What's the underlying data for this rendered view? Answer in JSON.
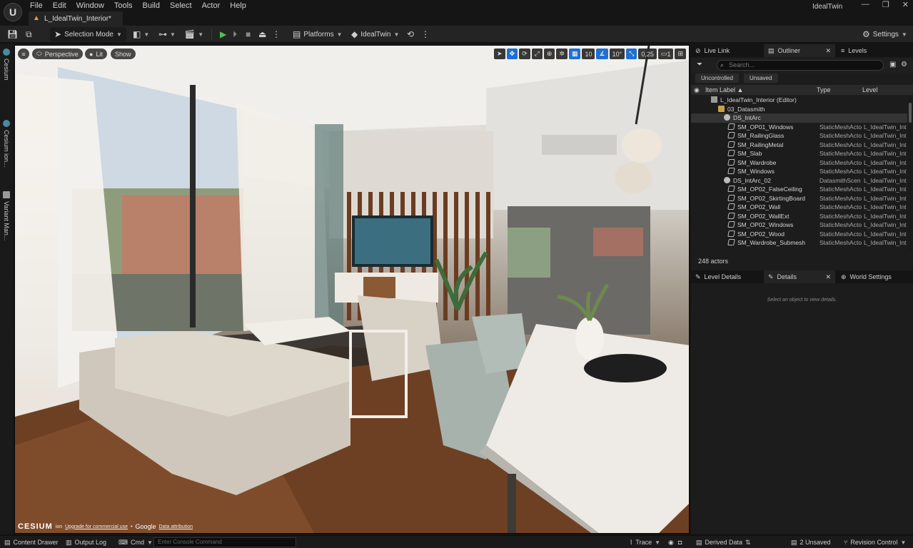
{
  "window": {
    "project_name": "IdealTwin",
    "document_tab": "L_IdealTwin_Interior*",
    "controls": [
      "—",
      "❐",
      "✕"
    ]
  },
  "menu": [
    "File",
    "Edit",
    "Window",
    "Tools",
    "Build",
    "Select",
    "Actor",
    "Help"
  ],
  "toolbar": {
    "selection_mode": "Selection Mode",
    "platforms": "Platforms",
    "ideal_twin": "IdealTwin",
    "settings": "Settings"
  },
  "left_strip": [
    "Cesium",
    "Cesium ion...",
    "Variant Man..."
  ],
  "viewport": {
    "perspective": "Perspective",
    "lit": "Lit",
    "show": "Show",
    "grid_size": "10",
    "rotation_snap": "10°",
    "scale_snap": "0,25",
    "camera_speed": "1",
    "credit": {
      "brand": "CESIUM",
      "ion": "ion",
      "upgrade": "Upgrade for commercial use",
      "google": "Google",
      "attribution": "Data attribution"
    }
  },
  "right_panel": {
    "top_tabs": [
      "Live Link",
      "Outliner",
      "Levels"
    ],
    "search_placeholder": "Search...",
    "filters": [
      "Uncontrolled",
      "Unsaved"
    ],
    "columns": [
      "Item Label ▲",
      "Type",
      "Level"
    ],
    "tree": [
      {
        "name": "L_IdealTwin_Interior (Editor)",
        "type": "",
        "level": "",
        "indent": 28,
        "icon": "lvl"
      },
      {
        "name": "03_Datasmith",
        "type": "",
        "level": "",
        "indent": 38,
        "icon": "folder"
      },
      {
        "name": "DS_IntArc",
        "type": "",
        "level": "",
        "indent": 46,
        "icon": "ds",
        "sel": true
      },
      {
        "name": "SM_OP01_Windows",
        "type": "StaticMeshActo",
        "level": "L_IdealTwin_Int",
        "indent": 52,
        "icon": "mesh"
      },
      {
        "name": "SM_RailingGlass",
        "type": "StaticMeshActo",
        "level": "L_IdealTwin_Int",
        "indent": 52,
        "icon": "mesh"
      },
      {
        "name": "SM_RailingMetal",
        "type": "StaticMeshActo",
        "level": "L_IdealTwin_Int",
        "indent": 52,
        "icon": "mesh"
      },
      {
        "name": "SM_Slab",
        "type": "StaticMeshActo",
        "level": "L_IdealTwin_Int",
        "indent": 52,
        "icon": "mesh"
      },
      {
        "name": "SM_Wardrobe",
        "type": "StaticMeshActo",
        "level": "L_IdealTwin_Int",
        "indent": 52,
        "icon": "mesh"
      },
      {
        "name": "SM_Windows",
        "type": "StaticMeshActo",
        "level": "L_IdealTwin_Int",
        "indent": 52,
        "icon": "mesh"
      },
      {
        "name": "DS_IntArc_02",
        "type": "DatasmithScen",
        "level": "L_IdealTwin_Int",
        "indent": 46,
        "icon": "ds"
      },
      {
        "name": "SM_OP02_FalseCeiling",
        "type": "StaticMeshActo",
        "level": "L_IdealTwin_Int",
        "indent": 52,
        "icon": "mesh"
      },
      {
        "name": "SM_OP02_SkirtingBoard",
        "type": "StaticMeshActo",
        "level": "L_IdealTwin_Int",
        "indent": 52,
        "icon": "mesh"
      },
      {
        "name": "SM_OP02_Wall",
        "type": "StaticMeshActo",
        "level": "L_IdealTwin_Int",
        "indent": 52,
        "icon": "mesh"
      },
      {
        "name": "SM_OP02_WallExt",
        "type": "StaticMeshActo",
        "level": "L_IdealTwin_Int",
        "indent": 52,
        "icon": "mesh"
      },
      {
        "name": "SM_OP02_Windows",
        "type": "StaticMeshActo",
        "level": "L_IdealTwin_Int",
        "indent": 52,
        "icon": "mesh"
      },
      {
        "name": "SM_OP02_Wood",
        "type": "StaticMeshActo",
        "level": "L_IdealTwin_Int",
        "indent": 52,
        "icon": "mesh"
      },
      {
        "name": "SM_Wardrobe_Submesh",
        "type": "StaticMeshActo",
        "level": "L_IdealTwin_Int",
        "indent": 52,
        "icon": "mesh"
      }
    ],
    "actor_count": "248 actors",
    "bottom_tabs": [
      "Level Details",
      "Details",
      "World Settings"
    ],
    "details_hint": "Select an object to view details."
  },
  "statusbar": {
    "content_drawer": "Content Drawer",
    "output_log": "Output Log",
    "cmd": "Cmd",
    "console_placeholder": "Enter Console Command",
    "trace": "Trace",
    "derived_data": "Derived Data",
    "unsaved": "2 Unsaved",
    "revision_control": "Revision Control"
  }
}
